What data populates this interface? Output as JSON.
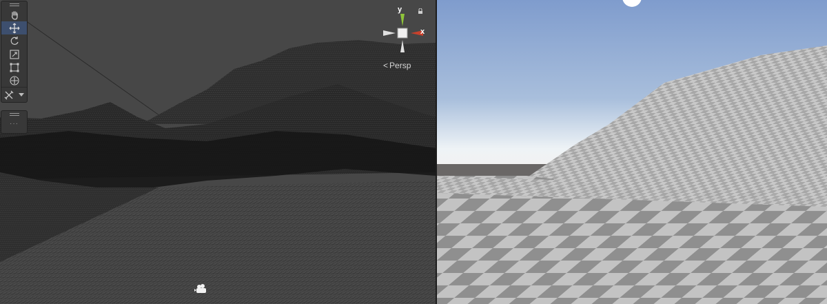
{
  "scene_view": {
    "camera_mode": "Persp",
    "axis_labels": {
      "y": "y",
      "x": "x"
    },
    "tools": [
      {
        "name": "hand-tool",
        "icon": "hand-icon",
        "active": false
      },
      {
        "name": "move-tool",
        "icon": "move-arrows-icon",
        "active": true
      },
      {
        "name": "rotate-tool",
        "icon": "rotate-icon",
        "active": false
      },
      {
        "name": "scale-tool",
        "icon": "scale-icon",
        "active": false
      },
      {
        "name": "rect-tool",
        "icon": "rect-transform-icon",
        "active": false
      },
      {
        "name": "transform-tool",
        "icon": "transform-icon",
        "active": false
      },
      {
        "name": "custom-tools-dropdown",
        "icon": "tools-icon",
        "active": false
      }
    ],
    "overlay_menu_dots": "···",
    "colors": {
      "background": "#474747",
      "wireframe": "#1a1a1a",
      "axis_x": "#c8412c",
      "axis_y": "#8fc43a",
      "axis_z": "#e0e0e0"
    }
  },
  "game_view": {
    "colors": {
      "sky_top": "#8aa3cf",
      "sky_horizon": "#e6edf3",
      "ground": "#6f6c6a",
      "checker_light": "#bdbdbd",
      "checker_dark": "#8e8e8e"
    }
  }
}
